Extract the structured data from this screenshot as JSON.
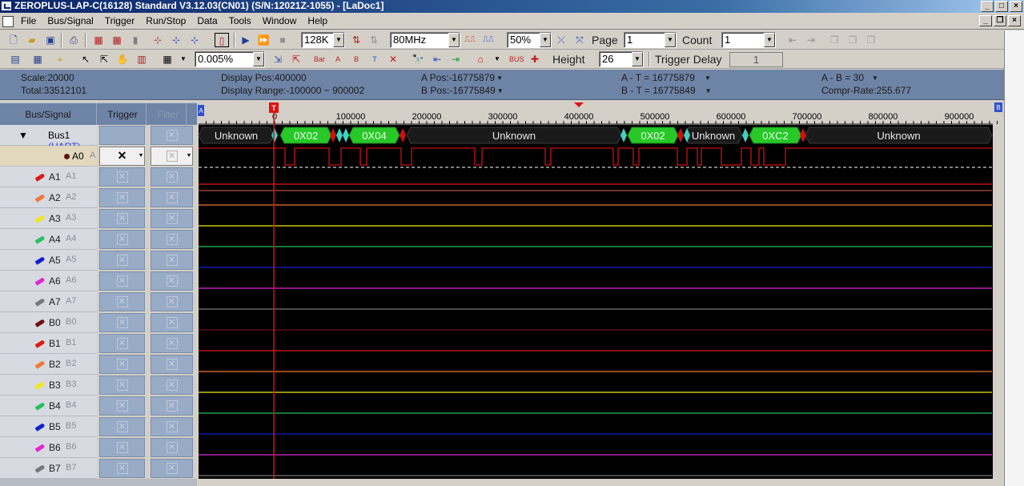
{
  "window": {
    "title": "ZEROPLUS-LAP-C(16128) Standard V3.12.03(CN01) (S/N:12021Z-1055) - [LaDoc1]",
    "buttons": [
      "_",
      "□",
      "×"
    ]
  },
  "menu": {
    "items": [
      "File",
      "Bus/Signal",
      "Trigger",
      "Run/Stop",
      "Data",
      "Tools",
      "Window",
      "Help"
    ],
    "mdi_buttons": [
      "_",
      "❐",
      "×"
    ]
  },
  "toolbar1": {
    "memory": "128K",
    "frequency": "80MHz",
    "trigger_position": "50%",
    "page_label": "Page",
    "page_value": "1",
    "count_label": "Count",
    "count_value": "1"
  },
  "toolbar2": {
    "zoom": "0.005%",
    "height_label": "Height",
    "height_value": "26",
    "trigger_delay_label": "Trigger Delay",
    "trigger_delay_value": "1"
  },
  "info": {
    "scale": "Scale:20000",
    "total": "Total:33512101",
    "display_pos": "Display Pos:400000",
    "display_range": "Display Range:-100000 ~ 900002",
    "a_pos": "A Pos:-16775879",
    "b_pos": "B Pos:-16775849",
    "a_t": "A - T = 16775879",
    "b_t": "B - T = 16775849",
    "a_b": "A - B = 30",
    "compr_rate": "Compr-Rate:255.677"
  },
  "columns": {
    "bus_signal": "Bus/Signal",
    "trigger": "Trigger",
    "filter": "Filter"
  },
  "bus": {
    "name": "Bus1",
    "protocol": "(UART)"
  },
  "channels": [
    {
      "label": "A0",
      "alias": "A",
      "color": "#5e1414"
    },
    {
      "label": "A1",
      "alias": "A1",
      "color": "#e01818"
    },
    {
      "label": "A2",
      "alias": "A2",
      "color": "#f07838"
    },
    {
      "label": "A3",
      "alias": "A3",
      "color": "#f0e818"
    },
    {
      "label": "A4",
      "alias": "A4",
      "color": "#28c060"
    },
    {
      "label": "A5",
      "alias": "A5",
      "color": "#1020d0"
    },
    {
      "label": "A6",
      "alias": "A6",
      "color": "#e028d8"
    },
    {
      "label": "A7",
      "alias": "A7",
      "color": "#787878"
    },
    {
      "label": "B0",
      "alias": "B0",
      "color": "#701010"
    },
    {
      "label": "B1",
      "alias": "B1",
      "color": "#e01818"
    },
    {
      "label": "B2",
      "alias": "B2",
      "color": "#f07838"
    },
    {
      "label": "B3",
      "alias": "B3",
      "color": "#f0e818"
    },
    {
      "label": "B4",
      "alias": "B4",
      "color": "#28c060"
    },
    {
      "label": "B5",
      "alias": "B5",
      "color": "#1020d0"
    },
    {
      "label": "B6",
      "alias": "B6",
      "color": "#e028d8"
    },
    {
      "label": "B7",
      "alias": "B7",
      "color": "#787878"
    }
  ],
  "ruler": {
    "ticks": [
      "0",
      "100000",
      "200000",
      "300000",
      "400000",
      "500000",
      "600000",
      "700000",
      "800000",
      "900000"
    ],
    "trigger_marker": "T",
    "a_marker": "A",
    "b_marker": "B"
  },
  "bus_decode": {
    "segments": [
      "Unknown",
      "0X02",
      "0X04",
      "Unknown",
      "0X02",
      "Unknown",
      "0XC2",
      "Unknown"
    ]
  },
  "colors": {
    "wave_bg": "#000000",
    "bus_data": "#28c828",
    "a0_trace": "#d01010",
    "trigger_line": "#e01010",
    "info_bg": "#6e84a6"
  }
}
